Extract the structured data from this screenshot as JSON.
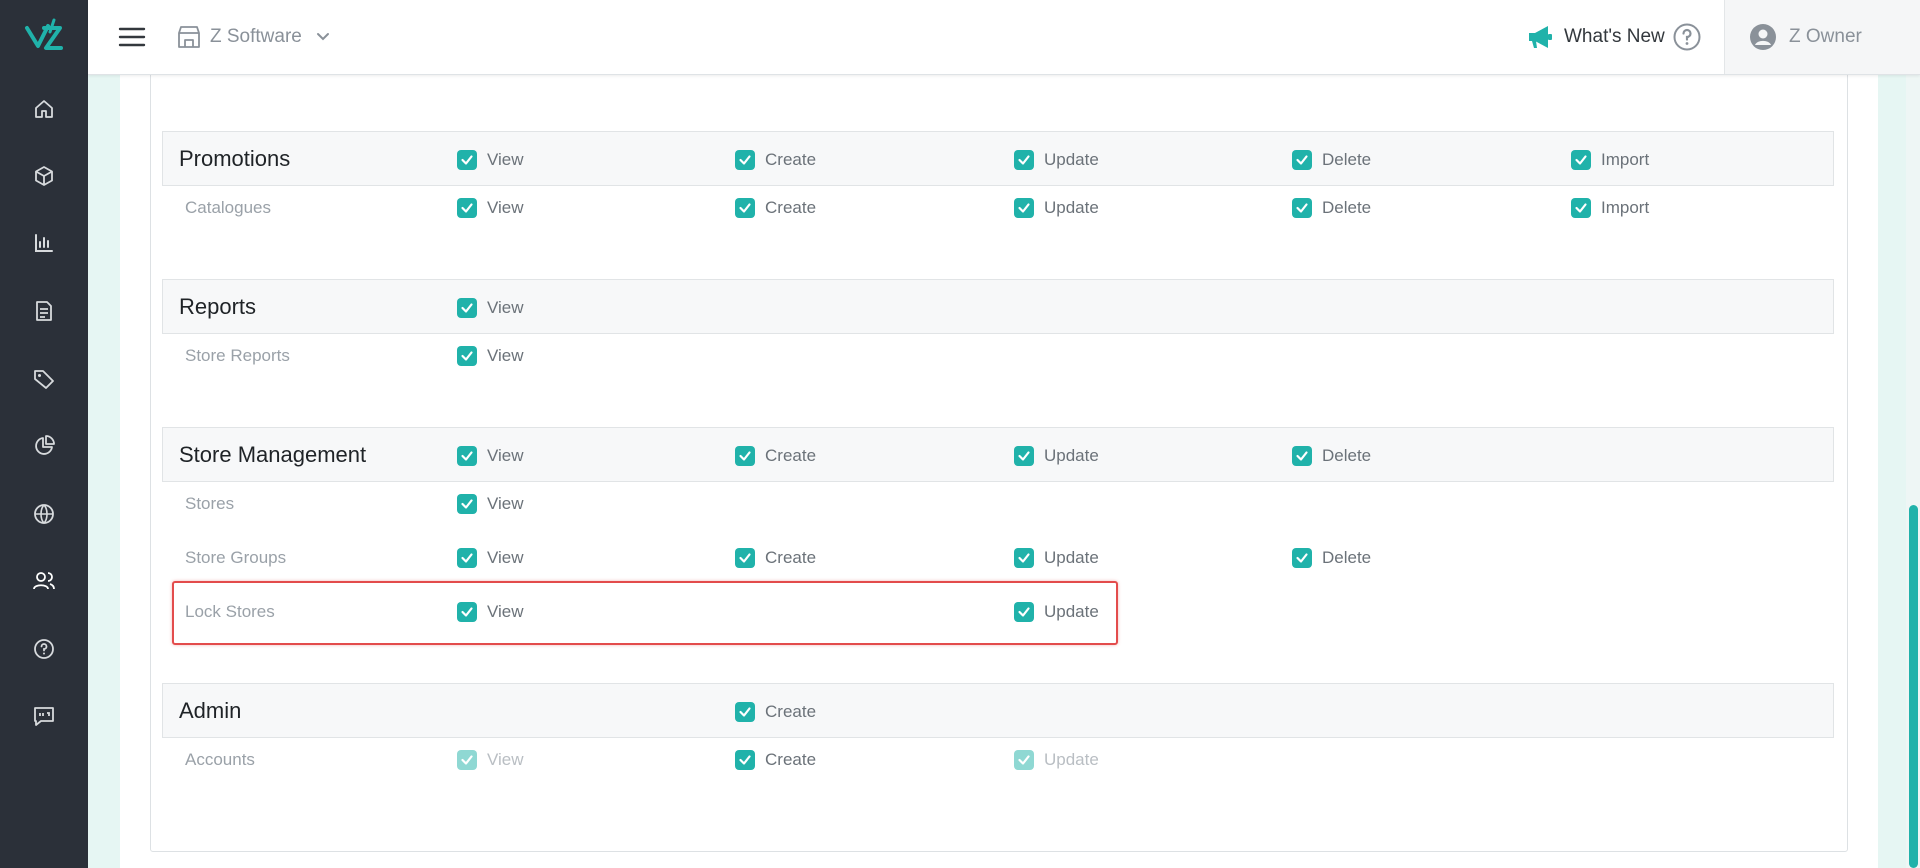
{
  "app": {
    "store_name": "Z Software",
    "whats_new": "What's New",
    "user_name": "Z Owner"
  },
  "colors": {
    "accent": "#20b2aa",
    "sidebar": "#2b3039",
    "highlight": "#e34c4c"
  },
  "sidebar": {
    "items": [
      {
        "icon": "home-icon"
      },
      {
        "icon": "box-icon"
      },
      {
        "icon": "bar-chart-icon"
      },
      {
        "icon": "report-icon"
      },
      {
        "icon": "tag-icon"
      },
      {
        "icon": "pie-chart-icon"
      },
      {
        "icon": "globe-icon"
      },
      {
        "icon": "users-icon"
      },
      {
        "icon": "help-circle-icon"
      },
      {
        "icon": "feedback-icon"
      }
    ]
  },
  "labels": {
    "view": "View",
    "create": "Create",
    "update": "Update",
    "delete": "Delete",
    "import": "Import"
  },
  "groups": {
    "promotions": {
      "title": "Promotions",
      "permissions": [
        "View",
        "Create",
        "Update",
        "Delete",
        "Import"
      ],
      "catalogues": {
        "label": "Catalogues",
        "permissions": [
          "View",
          "Create",
          "Update",
          "Delete",
          "Import"
        ]
      }
    },
    "reports": {
      "title": "Reports",
      "permissions": [
        "View"
      ],
      "store_reports": {
        "label": "Store Reports",
        "permissions": [
          "View"
        ]
      }
    },
    "store_management": {
      "title": "Store Management",
      "permissions": [
        "View",
        "Create",
        "Update",
        "Delete"
      ],
      "stores": {
        "label": "Stores",
        "permissions": [
          "View"
        ]
      },
      "store_groups": {
        "label": "Store Groups",
        "permissions": [
          "View",
          "Create",
          "Update",
          "Delete"
        ]
      },
      "lock_stores": {
        "label": "Lock Stores",
        "permissions": [
          "View",
          "Update"
        ]
      }
    },
    "admin": {
      "title": "Admin",
      "permissions": [
        "Create"
      ],
      "accounts": {
        "label": "Accounts",
        "permissions": [
          {
            "label": "View",
            "enabled": false
          },
          {
            "label": "Create",
            "enabled": true
          },
          {
            "label": "Update",
            "enabled": false
          }
        ]
      }
    }
  }
}
